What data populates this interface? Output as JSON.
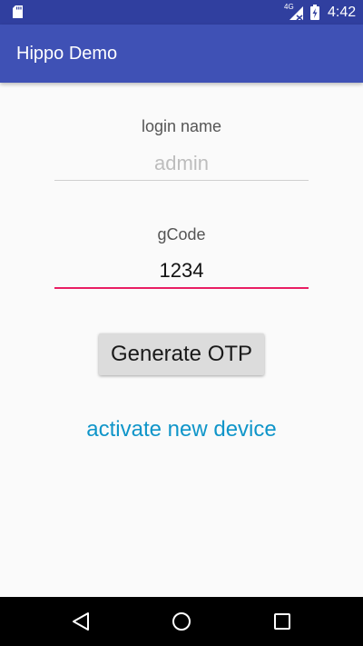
{
  "status_bar": {
    "time": "4:42",
    "network": "4G",
    "icons": [
      "sd-card-icon",
      "signal-icon",
      "battery-charging-icon"
    ]
  },
  "app_bar": {
    "title": "Hippo Demo",
    "color": "#3F51B5",
    "status_color": "#303F9F"
  },
  "form": {
    "login_label": "login name",
    "login_placeholder": "admin",
    "login_value": "",
    "gcode_label": "gCode",
    "gcode_value": "1234",
    "accent_color": "#E91E63"
  },
  "actions": {
    "generate_label": "Generate OTP",
    "activate_label": "activate new device",
    "link_color": "#0F95C9"
  },
  "nav_bar": {
    "icons": [
      "back-icon",
      "home-icon",
      "recents-icon"
    ]
  }
}
